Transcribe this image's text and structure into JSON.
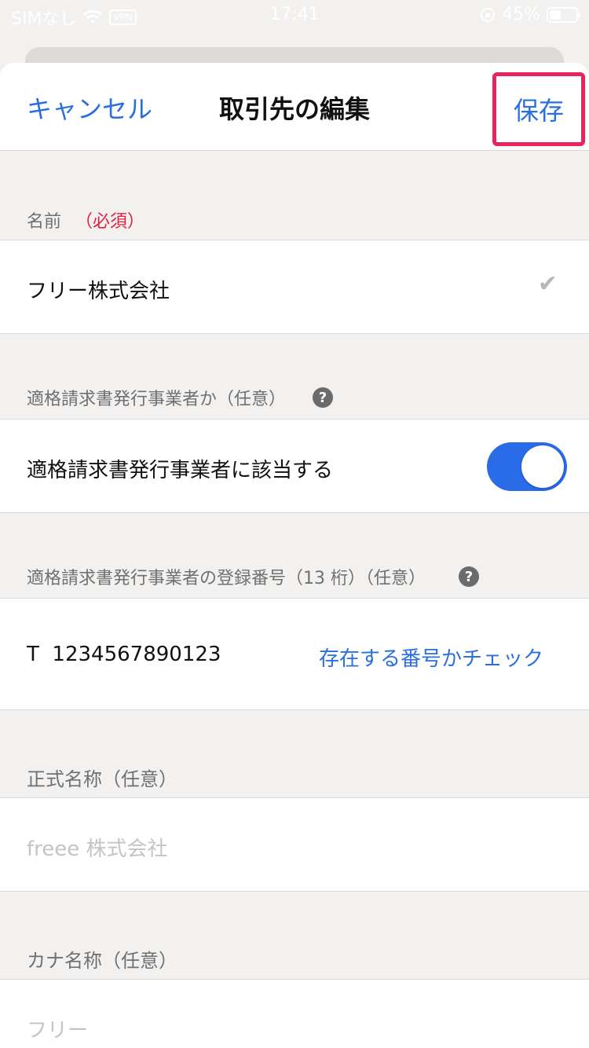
{
  "status_bar": {
    "carrier": "SIMなし",
    "vpn": "VPN",
    "time": "17:41",
    "battery": "45%",
    "battery_level": 0.45
  },
  "nav": {
    "cancel": "キャンセル",
    "title": "取引先の編集",
    "save": "保存"
  },
  "sections": {
    "name": {
      "label": "名前",
      "required": "（必須）",
      "value": "フリー株式会社"
    },
    "invoice_issuer": {
      "label": "適格請求書発行事業者か（任意）",
      "toggle_label": "適格請求書発行事業者に該当する",
      "toggle_on": true
    },
    "registration_number": {
      "label": "適格請求書発行事業者の登録番号（13 桁）（任意）",
      "value": "T  1234567890123",
      "check_link": "存在する番号かチェック"
    },
    "official_name": {
      "label": "正式名称（任意）",
      "placeholder": "freee 株式会社"
    },
    "kana_name": {
      "label": "カナ名称（任意）",
      "placeholder": "フリー"
    }
  },
  "colors": {
    "accent": "#2a6fe0",
    "required": "#e02040",
    "highlight_border": "#e8245c",
    "toggle_on": "#2a6be8"
  }
}
